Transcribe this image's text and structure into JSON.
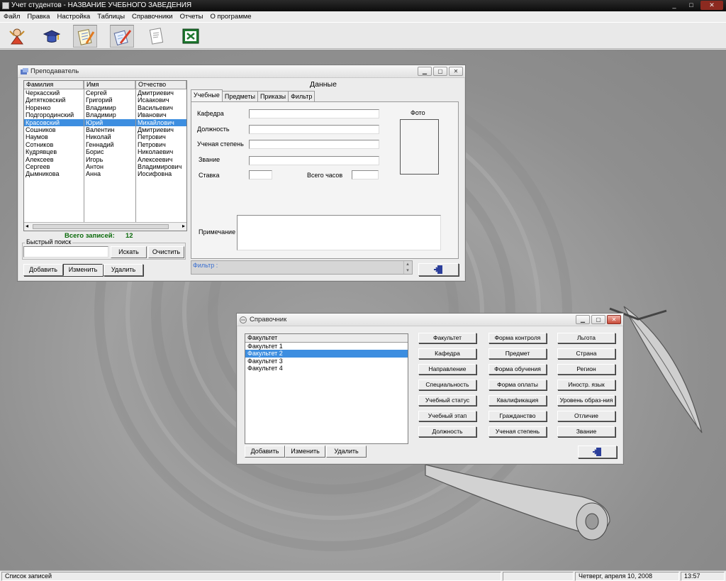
{
  "app": {
    "title": "Учет студентов - НАЗВАНИЕ УЧЕБНОГО ЗАВЕДЕНИЯ"
  },
  "menu": [
    "Файл",
    "Правка",
    "Настройка",
    "Таблицы",
    "Справочники",
    "Отчеты",
    "О программе"
  ],
  "toolbar": {
    "icons": [
      "teacher-icon",
      "graduation-cap-icon",
      "notepad-pencil-icon",
      "edit-orders-icon",
      "document-icon",
      "excel-icon"
    ]
  },
  "teacher_window": {
    "title": "Преподаватель",
    "columns": [
      "Фамилия",
      "Имя",
      "Отчество"
    ],
    "rows": [
      [
        "Черкасский",
        "Сергей",
        "Дмитриевич"
      ],
      [
        "Дитятковский",
        "Григорий",
        "Исаакович"
      ],
      [
        "Норенко",
        "Владимир",
        "Васильевич"
      ],
      [
        "Подгородинский",
        "Владимир",
        "Иванович"
      ],
      [
        "Красовский",
        "Юрий",
        "Михайлович"
      ],
      [
        "Сошников",
        "Валентин",
        "Дмитриевич"
      ],
      [
        "Наумов",
        "Николай",
        "Петрович"
      ],
      [
        "Сотников",
        "Геннадий",
        "Петрович"
      ],
      [
        "Кудрявцев",
        "Борис",
        "Николаевич"
      ],
      [
        "Алексеев",
        "Игорь",
        "Алексеевич"
      ],
      [
        "Сергеев",
        "Антон",
        "Владимирович"
      ],
      [
        "Дымникова",
        "Анна",
        "Иосифовна"
      ]
    ],
    "selected_row": 4,
    "records_label": "Всего записей:",
    "records_count": "12",
    "quick_search": {
      "legend": "Быстрый поиск",
      "value": "",
      "search_button": "Искать",
      "clear_button": "Очистить"
    },
    "buttons": {
      "add": "Добавить",
      "edit": "Изменить",
      "delete": "Удалить"
    },
    "data_title": "Данные",
    "tabs": [
      "Учебные",
      "Предметы",
      "Приказы",
      "Фильтр"
    ],
    "active_tab": 0,
    "fields": {
      "department": {
        "label": "Кафедра",
        "value": ""
      },
      "position": {
        "label": "Должность",
        "value": ""
      },
      "degree": {
        "label": "Ученая степень",
        "value": ""
      },
      "rank": {
        "label": "Звание",
        "value": ""
      },
      "rate": {
        "label": "Ставка",
        "value": ""
      },
      "hours": {
        "label": "Всего часов",
        "value": ""
      },
      "note": {
        "label": "Примечание",
        "value": ""
      }
    },
    "photo_label": "Фото",
    "filter_text": "Фильтр :"
  },
  "reference_window": {
    "title": "Справочник",
    "column": "Факультет",
    "items": [
      "Факультет 1",
      "Факультет 2",
      "Факультет 3",
      "Факультет 4"
    ],
    "selected_item": 1,
    "buttons": {
      "add": "Добавить",
      "edit": "Изменить",
      "delete": "Удалить"
    },
    "reference_buttons": [
      [
        "Факультет",
        "Форма контроля",
        "Льгота"
      ],
      [
        "Кафедра",
        "Предмет",
        "Страна"
      ],
      [
        "Направление",
        "Форма обучения",
        "Регион"
      ],
      [
        "Специальность",
        "Форма оплаты",
        "Иностр. язык"
      ],
      [
        "Учебный статус",
        "Квалификация",
        "Уровень образ-ния"
      ],
      [
        "Учебный этап",
        "Гражданство",
        "Отличие"
      ],
      [
        "Должность",
        "Ученая степень",
        "Звание"
      ]
    ]
  },
  "status": {
    "left": "Список записей",
    "date": "Четверг, апреля 10, 2008",
    "time": "13:57"
  },
  "colors": {
    "selection": "#3d8ee0",
    "records": "#0a6a0a",
    "filter_text": "#3a6fd0"
  }
}
